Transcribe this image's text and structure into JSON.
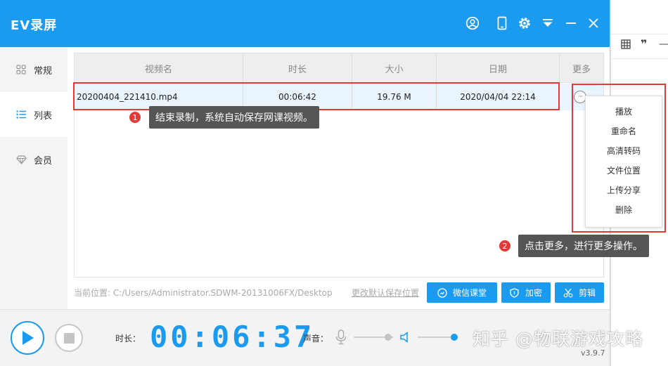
{
  "app": {
    "title": "EV录屏",
    "version": "v3.9.7"
  },
  "colors": {
    "accent": "#1a9bf0",
    "highlight_red": "#e53935",
    "row_selected": "#eaf4fd",
    "tooltip_bg": "#555555"
  },
  "titlebar_icons": [
    "user-icon",
    "mobile-icon",
    "gear-icon",
    "dropdown-icon",
    "minimize-icon",
    "close-icon"
  ],
  "sidebar": {
    "items": [
      {
        "label": "常规",
        "icon": "grid-icon",
        "active": false
      },
      {
        "label": "列表",
        "icon": "list-icon",
        "active": true
      },
      {
        "label": "会员",
        "icon": "diamond-icon",
        "active": false
      }
    ]
  },
  "table": {
    "headers": [
      "视频名",
      "时长",
      "大小",
      "日期",
      "更多"
    ],
    "rows": [
      {
        "name": "20200404_221410.mp4",
        "duration": "00:06:42",
        "size": "19.76 M",
        "date": "2020/04/04 22:14",
        "more": "···"
      }
    ]
  },
  "context_menu": {
    "items": [
      "播放",
      "重命名",
      "高清转码",
      "文件位置",
      "上传分享",
      "删除"
    ]
  },
  "callouts": [
    {
      "number": "1",
      "text": "结束录制，系统自动保存网课视频。"
    },
    {
      "number": "2",
      "text": "点击更多，进行更多操作。"
    }
  ],
  "path": {
    "label": "当前位置:",
    "value": "C:/Users/Administrator.SDWM-20131006FX/Desktop",
    "change_link": "更改默认保存位置"
  },
  "actions": [
    {
      "label": "微信课堂",
      "icon": "wechat-class-icon"
    },
    {
      "label": "加密",
      "icon": "shield-icon"
    },
    {
      "label": "剪辑",
      "icon": "scissors-icon"
    }
  ],
  "controls": {
    "duration_label": "时长：",
    "timer": "00:06:37",
    "volume_label": "声音：",
    "mic_level": 0.88,
    "speaker_level": 1.0
  },
  "background_window": {
    "icons": [
      "table-icon",
      "quote-icon",
      "dash-icon"
    ]
  },
  "watermark": "知乎 @物联游戏攻略"
}
